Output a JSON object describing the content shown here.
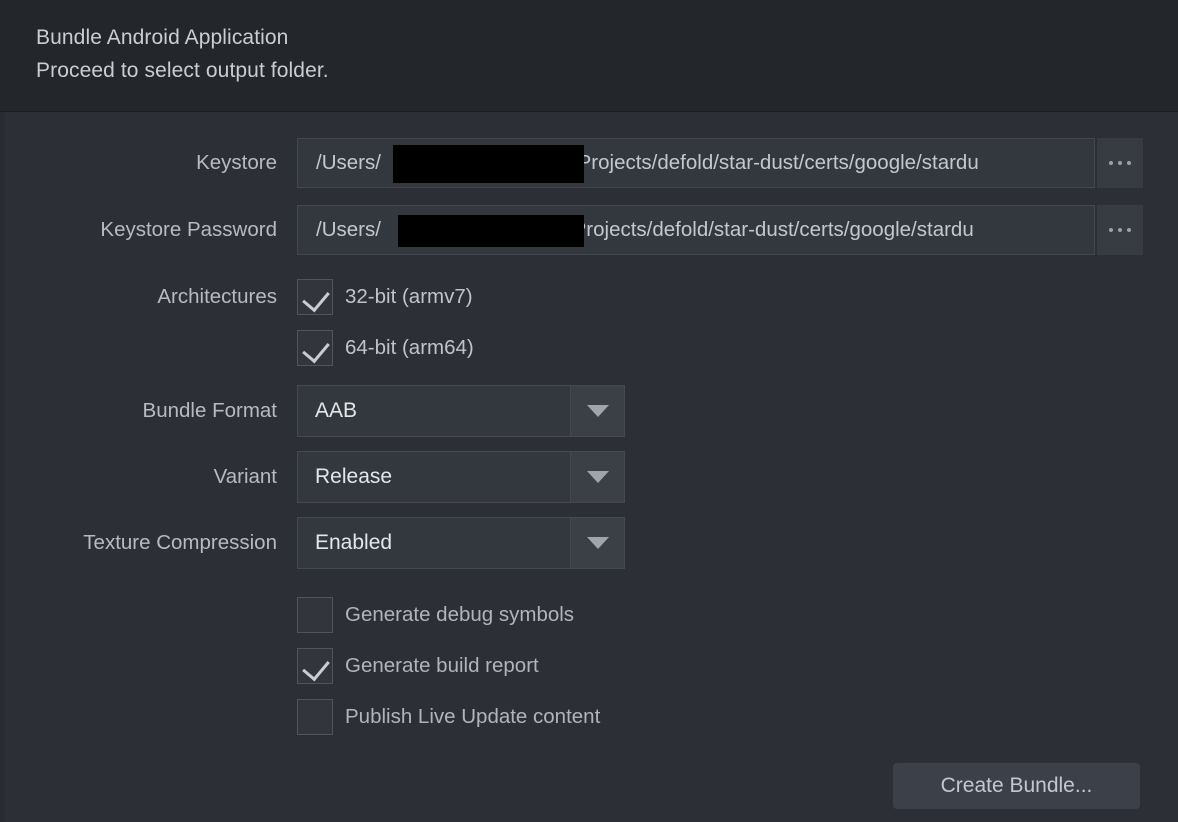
{
  "dialog": {
    "title": "Bundle Android Application",
    "subtitle": "Proceed to select output folder."
  },
  "fields": {
    "keystore": {
      "label": "Keystore",
      "value": "/Users/",
      "value_suffix": "/Projects/defold/star-dust/certs/google/stardu",
      "redacted": true,
      "browse_label": "..."
    },
    "keystore_password": {
      "label": "Keystore Password",
      "value": "/Users/",
      "value_suffix": "/Projects/defold/star-dust/certs/google/stardu",
      "redacted": true,
      "browse_label": "..."
    }
  },
  "architectures": {
    "label": "Architectures",
    "options": [
      {
        "label": "32-bit (armv7)",
        "checked": true
      },
      {
        "label": "64-bit (arm64)",
        "checked": true
      }
    ]
  },
  "selects": {
    "bundle_format": {
      "label": "Bundle Format",
      "value": "AAB"
    },
    "variant": {
      "label": "Variant",
      "value": "Release"
    },
    "texture_compression": {
      "label": "Texture Compression",
      "value": "Enabled"
    }
  },
  "options": [
    {
      "label": "Generate debug symbols",
      "checked": false
    },
    {
      "label": "Generate build report",
      "checked": true
    },
    {
      "label": "Publish Live Update content",
      "checked": false
    }
  ],
  "actions": {
    "create_bundle": "Create Bundle..."
  },
  "colors": {
    "header_bg": "#23272c",
    "body_bg": "#2c3036",
    "field_bg": "#33383e",
    "text": "#c7ccd1",
    "button_bg": "#3c4149"
  }
}
